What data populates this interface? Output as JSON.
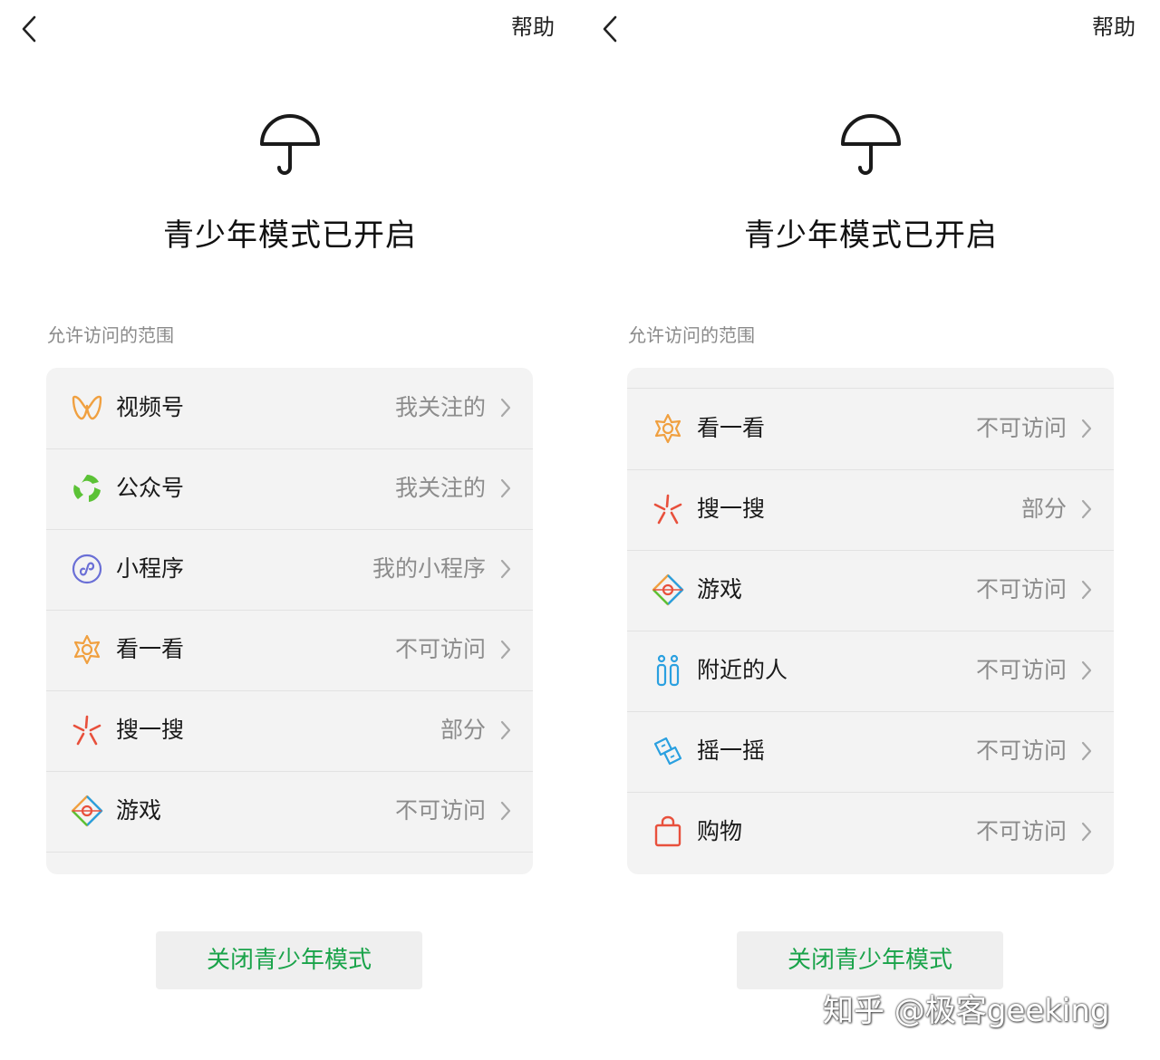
{
  "help_label": "帮助",
  "title": "青少年模式已开启",
  "section_label": "允许访问的范围",
  "close_button_label": "关闭青少年模式",
  "watermark": "知乎 @极客geeking",
  "left_screen": {
    "items": [
      {
        "icon": "channels-icon",
        "label": "视频号",
        "value": "我关注的"
      },
      {
        "icon": "official-accounts-icon",
        "label": "公众号",
        "value": "我关注的"
      },
      {
        "icon": "mini-programs-icon",
        "label": "小程序",
        "value": "我的小程序"
      },
      {
        "icon": "top-stories-icon",
        "label": "看一看",
        "value": "不可访问"
      },
      {
        "icon": "search-icon",
        "label": "搜一搜",
        "value": "部分"
      },
      {
        "icon": "games-icon",
        "label": "游戏",
        "value": "不可访问"
      }
    ]
  },
  "right_screen": {
    "items": [
      {
        "icon": "top-stories-icon",
        "label": "看一看",
        "value": "不可访问"
      },
      {
        "icon": "search-icon",
        "label": "搜一搜",
        "value": "部分"
      },
      {
        "icon": "games-icon",
        "label": "游戏",
        "value": "不可访问"
      },
      {
        "icon": "people-nearby-icon",
        "label": "附近的人",
        "value": "不可访问"
      },
      {
        "icon": "shake-icon",
        "label": "摇一摇",
        "value": "不可访问"
      },
      {
        "icon": "shopping-icon",
        "label": "购物",
        "value": "不可访问"
      }
    ]
  },
  "colors": {
    "accent_green": "#1aa34a",
    "channels": "#f0a040",
    "official_accounts": "#5bc236",
    "mini_programs": "#6a6fd6",
    "top_stories": "#f0a040",
    "search": "#e8503c",
    "people_nearby": "#2aa0e0",
    "shake": "#2aa0e0",
    "shopping": "#e8503c"
  }
}
